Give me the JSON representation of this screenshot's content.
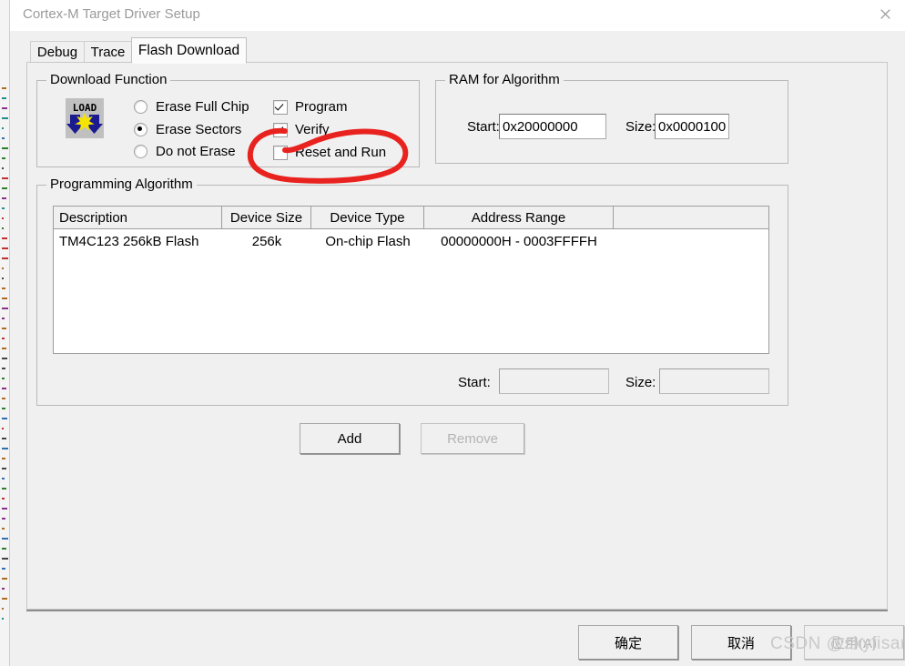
{
  "window": {
    "title": "Cortex-M Target Driver Setup",
    "close_icon": "close-icon"
  },
  "tabs": [
    {
      "label": "Debug",
      "active": false
    },
    {
      "label": "Trace",
      "active": false
    },
    {
      "label": "Flash Download",
      "active": true
    }
  ],
  "download_function": {
    "title": "Download Function",
    "icon": "load-icon",
    "icon_text": "LOAD",
    "radios": [
      {
        "label": "Erase Full Chip",
        "checked": false
      },
      {
        "label": "Erase Sectors",
        "checked": true
      },
      {
        "label": "Do not Erase",
        "checked": false
      }
    ],
    "checkboxes": [
      {
        "label": "Program",
        "checked": true
      },
      {
        "label": "Verify",
        "checked": true
      },
      {
        "label": "Reset and Run",
        "checked": false
      }
    ]
  },
  "ram_for_algorithm": {
    "title": "RAM for Algorithm",
    "start_label": "Start:",
    "start_value": "0x20000000",
    "size_label": "Size:",
    "size_value": "0x0000100"
  },
  "programming_algorithm": {
    "title": "Programming Algorithm",
    "columns": [
      "Description",
      "Device Size",
      "Device Type",
      "Address Range",
      ""
    ],
    "rows": [
      [
        "TM4C123 256kB Flash",
        "256k",
        "On-chip Flash",
        "00000000H - 0003FFFFH",
        ""
      ]
    ],
    "start_label": "Start:",
    "start_value": "",
    "size_label": "Size:",
    "size_value": "",
    "add_label": "Add",
    "remove_label": "Remove",
    "remove_disabled": true
  },
  "footer": {
    "ok_label": "确定",
    "cancel_label": "取消",
    "apply_label": "应用(A)",
    "apply_disabled": true
  },
  "watermark": {
    "text": "CSDN @skyfisan"
  },
  "colors": {
    "dialog_bg": "#f0f0f0",
    "titlebar_bg": "#ffffff",
    "annotation_red": "#e8231f",
    "icon_blue": "#1b1b8f",
    "icon_yellow": "#f5e400",
    "disabled_text": "#b4b4b4"
  }
}
